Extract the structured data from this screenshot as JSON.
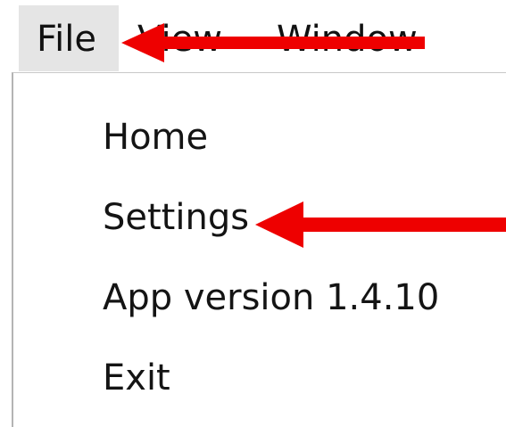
{
  "menubar": {
    "items": [
      {
        "label": "File"
      },
      {
        "label": "View"
      },
      {
        "label": "Window"
      }
    ]
  },
  "file_menu": {
    "items": [
      {
        "label": "Home"
      },
      {
        "label": "Settings"
      },
      {
        "label": "App version 1.4.10"
      },
      {
        "label": "Exit"
      }
    ]
  },
  "annotations": {
    "arrow_color": "#ee0000",
    "arrows": [
      {
        "points_to": "File"
      },
      {
        "points_to": "Settings"
      }
    ]
  }
}
